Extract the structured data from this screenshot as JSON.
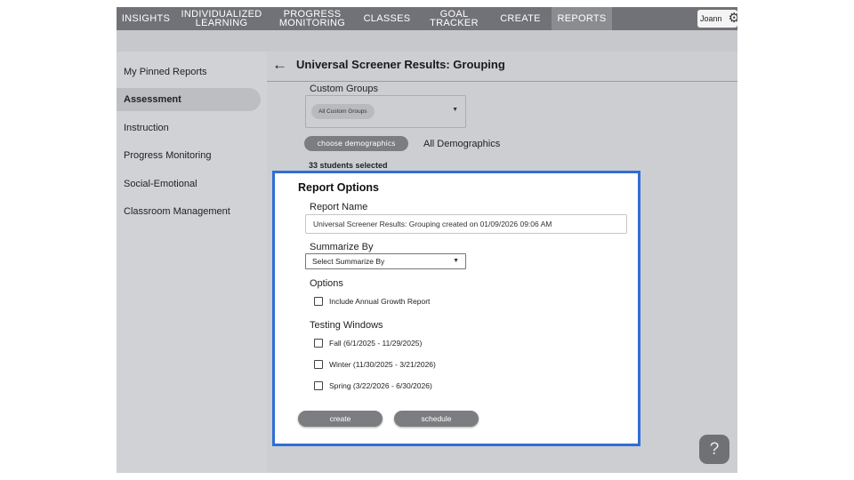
{
  "nav": {
    "items": [
      {
        "label": "INSIGHTS"
      },
      {
        "label": "INDIVIDUALIZED LEARNING"
      },
      {
        "label": "PROGRESS MONITORING"
      },
      {
        "label": "CLASSES"
      },
      {
        "label": "GOAL TRACKER"
      },
      {
        "label": "CREATE"
      },
      {
        "label": "REPORTS",
        "active": true
      }
    ],
    "user_name": "Joann",
    "user_icon": "gear-icon"
  },
  "sidebar": {
    "items": [
      {
        "label": "My Pinned Reports"
      },
      {
        "label": "Assessment",
        "active": true
      },
      {
        "label": "Instruction"
      },
      {
        "label": "Progress Monitoring"
      },
      {
        "label": "Social-Emotional"
      },
      {
        "label": "Classroom Management"
      }
    ]
  },
  "main": {
    "back_icon": "back-arrow-icon",
    "title": "Universal Screener Results: Grouping",
    "custom_groups": {
      "label": "Custom Groups",
      "selected_chip": "All Custom Groups"
    },
    "demographics": {
      "button_label": "choose demographics",
      "value": "All Demographics"
    },
    "students_selected": "33 students selected"
  },
  "report_options": {
    "title": "Report Options",
    "report_name": {
      "label": "Report Name",
      "value": "Universal Screener Results: Grouping created on 01/09/2026 09:06 AM"
    },
    "summarize_by": {
      "label": "Summarize By",
      "value": "Select Summarize By"
    },
    "options": {
      "label": "Options",
      "items": [
        {
          "label": "Include Annual Growth Report",
          "checked": false
        }
      ]
    },
    "testing_windows": {
      "label": "Testing Windows",
      "items": [
        {
          "label": "Fall (6/1/2025 - 11/29/2025)",
          "checked": false
        },
        {
          "label": "Winter (11/30/2025 - 3/21/2026)",
          "checked": false
        },
        {
          "label": "Spring (3/22/2026 - 6/30/2026)",
          "checked": false
        }
      ]
    },
    "create_label": "create",
    "schedule_label": "schedule"
  },
  "help": {
    "label": "?"
  },
  "colors": {
    "nav_bg": "#707277",
    "nav_active": "#8a8c90",
    "panel_border": "#2f6fd6",
    "button_bg": "#7b7d81",
    "page_bg": "#ccced2"
  }
}
